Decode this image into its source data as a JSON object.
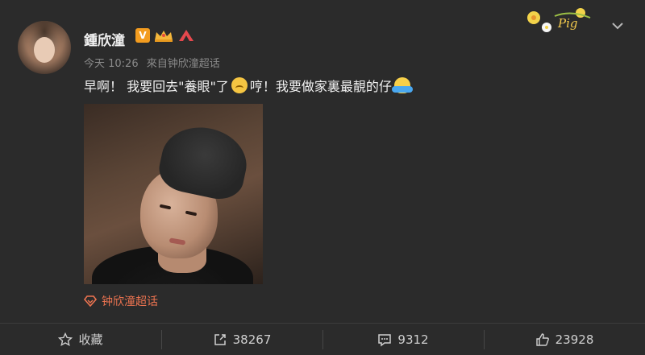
{
  "user": {
    "name": "鍾欣潼",
    "badge_v": "V"
  },
  "meta": {
    "time": "今天 10:26",
    "source": "來自钟欣潼超话"
  },
  "post": {
    "text_part1": "早啊！ 我要回去\"養眼\"了",
    "text_part2": " 哼！我要做家裏最靚的仔",
    "emoji1": "sad-face-emoji",
    "emoji2": "hug-emoji"
  },
  "topic": {
    "label": "钟欣潼超话"
  },
  "actions": {
    "favorite_label": "收藏",
    "repost_count": "38267",
    "comment_count": "9312",
    "like_count": "23928"
  },
  "decoration": {
    "card_text": "Pig"
  },
  "colors": {
    "background": "#2b2b2b",
    "accent_orange": "#eb7350",
    "verified": "#f39c1f"
  }
}
